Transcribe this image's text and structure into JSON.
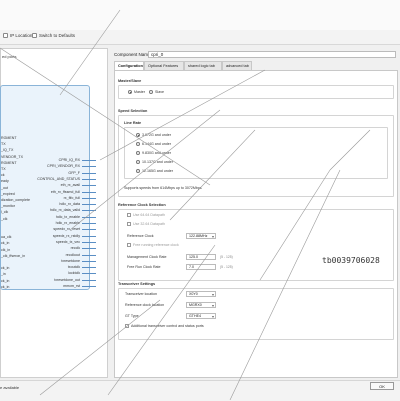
{
  "toolbar": {
    "ip_location_label": "IP Location",
    "switch_defaults_label": "Switch to Defaults"
  },
  "left_panel": {
    "show_ports_label": "ed ports",
    "left_pins": [
      "RGMENT",
      "TX",
      "_IQ_TX",
      "VENDOR_TX",
      "RGMENT",
      "TX",
      "ck",
      "eady",
      "_out",
      "_expired",
      "dization_complete",
      "_monitor",
      "l_clk",
      "_clk",
      "",
      "",
      "ua_clk",
      "ck_in",
      "clk_in",
      "_clk_ffseron_in",
      "",
      "ck_in",
      "_in",
      "ck_in",
      "ck_in"
    ],
    "right_pins": [
      "CPRI_IQ_RX",
      "CPRI_VENDOR_RX",
      "GFP_F",
      "CONTROL_AND_STATUS",
      "eth_rx_avail",
      "eth_rx_ffssmd_full",
      "rx_fifo_full",
      "hdlc_rx_data",
      "hdlc_rx_data_valid",
      "hdlc_tx_enable",
      "hdlc_rx_enable",
      "speedx_rx_reset",
      "speedx_rx_rstdly",
      "speedx_tx_vec",
      "recclk",
      "recclkout",
      "txresetdone",
      "txoutclk",
      "locktclk",
      "txresetdone_out",
      "mmcm_rst"
    ]
  },
  "component": {
    "name_label": "Component Name",
    "name_value": "cpri_0"
  },
  "tabs": [
    {
      "label": "Configuration"
    },
    {
      "label": "Optional Features"
    },
    {
      "label": "shared logic tab"
    },
    {
      "label": "advanced tab"
    }
  ],
  "master_slave": {
    "title": "Master/Slave",
    "options": [
      {
        "label": "Master",
        "selected": true
      },
      {
        "label": "Slave",
        "selected": false
      }
    ]
  },
  "speed_selection": {
    "title": "Speed Selection",
    "line_rate_title": "Line Rate",
    "options": [
      {
        "label": "3.072G and under",
        "selected": true
      },
      {
        "label": "6.144G and under",
        "selected": false
      },
      {
        "label": "9.830G and under",
        "selected": false
      },
      {
        "label": "10.137G and under",
        "selected": false
      },
      {
        "label": "12.165G and under",
        "selected": false
      }
    ],
    "supports_text": "Supports speeds from 614Mbps up to 3072Mbps"
  },
  "ref_clock": {
    "title": "Reference Clock Selection",
    "use_64_label": "Use 64.64 Datapath",
    "use_32_label": "Use 32.64 Datapath",
    "ref_clock_label": "Reference Clock",
    "ref_clock_value": "122.88MHz",
    "free_running_label": "Free running reference clock",
    "mgmt_label": "Management Clock Rate",
    "mgmt_value": "125.0",
    "mgmt_range": "(5 - 125)",
    "free_run_label": "Free Run Clock Rate",
    "free_run_value": "7.0",
    "free_run_range": "(5 - 125)"
  },
  "transceiver": {
    "title": "Transceiver Settings",
    "loc_label": "Transceiver location",
    "loc_value": "X0Y0",
    "ref_loc_label": "Reference clock location",
    "ref_loc_value": "MGRX0",
    "gt_label": "GT Type",
    "gt_value": "GTHE4",
    "extra_label": "Additional transceiver control and status ports"
  },
  "watermark": "tb0039706028",
  "status": {
    "text": "e available",
    "ok_label": "OK"
  }
}
